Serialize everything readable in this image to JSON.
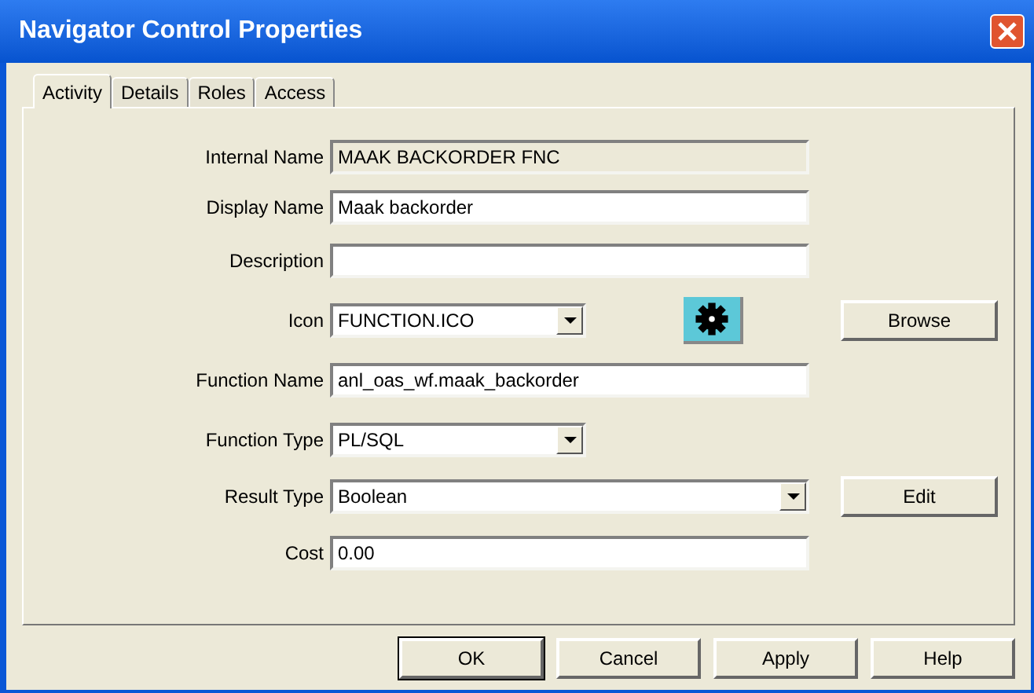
{
  "window": {
    "title": "Navigator Control Properties"
  },
  "tabs": [
    {
      "label": "Activity",
      "selected": true
    },
    {
      "label": "Details",
      "selected": false
    },
    {
      "label": "Roles",
      "selected": false
    },
    {
      "label": "Access",
      "selected": false
    }
  ],
  "fields": [
    {
      "label": "Internal Name",
      "kind": "text",
      "value": "MAAK BACKORDER FNC",
      "disabled": true
    },
    {
      "label": "Display Name",
      "kind": "text",
      "value": "Maak backorder",
      "disabled": false
    },
    {
      "label": "Description",
      "kind": "text",
      "disabled": false
    },
    {
      "label": "Icon",
      "kind": "icon-combo",
      "value": "FUNCTION.ICO",
      "disabled": false,
      "button": "Browse"
    },
    {
      "label": "Function Name",
      "kind": "text",
      "value": "anl_oas_wf.maak_backorder",
      "disabled": false
    },
    {
      "label": "Function Type",
      "kind": "short-combo",
      "value": "PL/SQL",
      "disabled": false
    },
    {
      "label": "Result Type",
      "kind": "combo",
      "value": "Boolean",
      "disabled": false,
      "button": "Edit"
    },
    {
      "label": "Cost",
      "kind": "text",
      "value": "0.00",
      "disabled": false
    }
  ],
  "buttons": [
    {
      "label": "OK",
      "default": true
    },
    {
      "label": "Cancel",
      "default": false
    },
    {
      "label": "Apply",
      "default": false
    },
    {
      "label": "Help",
      "default": false
    }
  ]
}
